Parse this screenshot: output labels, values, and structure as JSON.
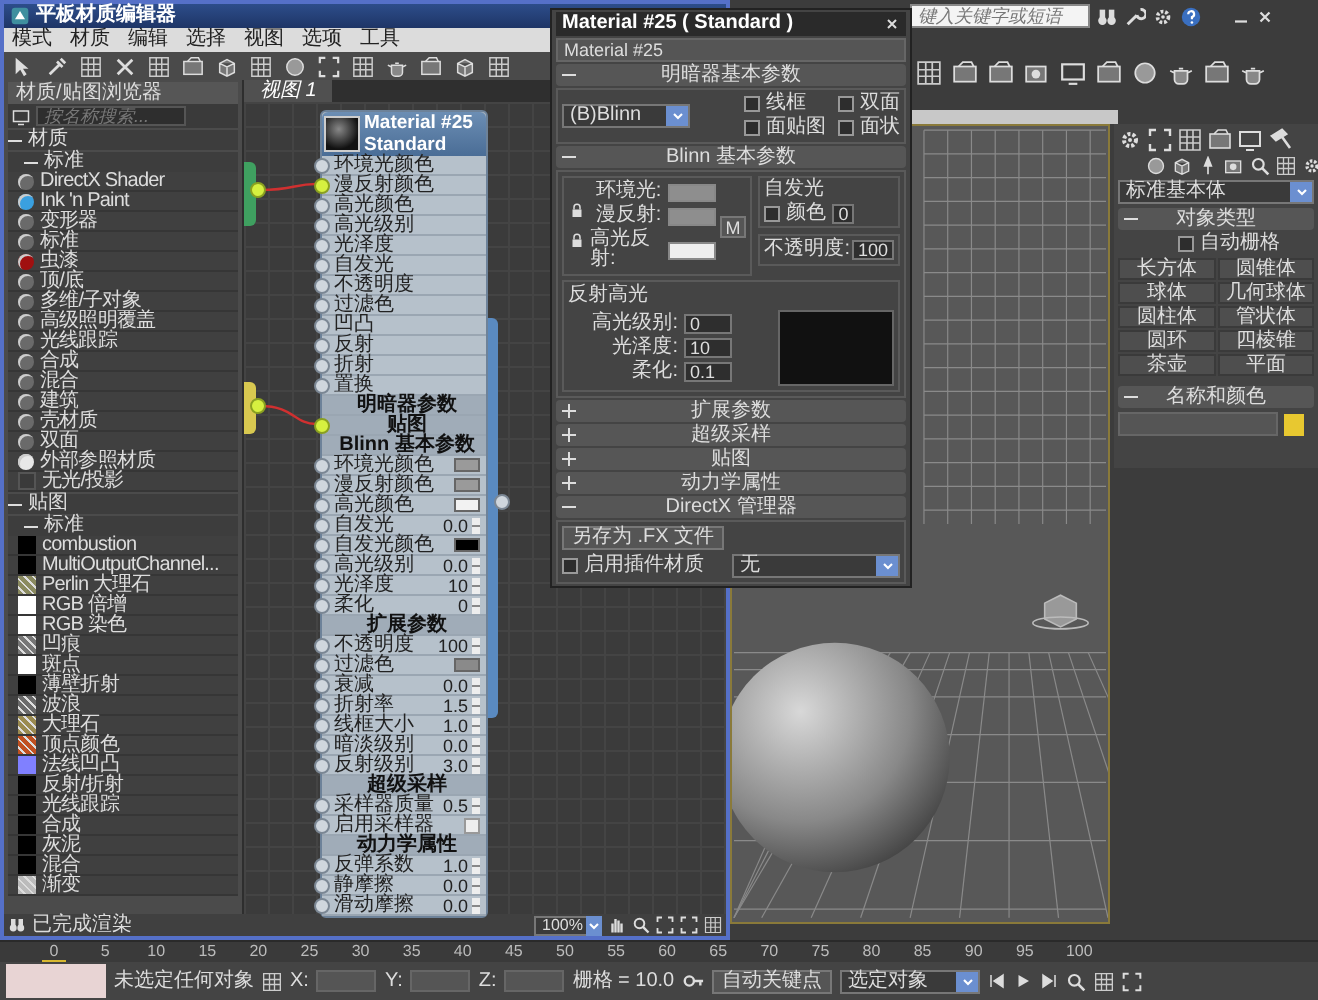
{
  "app": {
    "search": {
      "placeholder": "键入关键字或短语"
    }
  },
  "slate": {
    "title": "平板材质编辑器",
    "menu": [
      "模式",
      "材质",
      "编辑",
      "选择",
      "视图",
      "选项",
      "工具"
    ],
    "browser": {
      "title": "材质/贴图浏览器",
      "search": {
        "placeholder": "按名称搜索..."
      },
      "groups": [
        {
          "label": "材质",
          "expanded": true,
          "children": [
            {
              "label": "标准",
              "expanded": true,
              "items": [
                {
                  "label": "DirectX Shader",
                  "kind": "sphere",
                  "color": "#6a6a6a"
                },
                {
                  "label": "Ink 'n Paint",
                  "kind": "sphere",
                  "color": "#3aa0e0"
                },
                {
                  "label": "变形器",
                  "kind": "sphere",
                  "color": "#6a6a6a"
                },
                {
                  "label": "标准",
                  "kind": "sphere",
                  "color": "#6a6a6a"
                },
                {
                  "label": "虫漆",
                  "kind": "sphere",
                  "color": "#a01010"
                },
                {
                  "label": "顶/底",
                  "kind": "sphere",
                  "color": "#6a6a6a"
                },
                {
                  "label": "多维/子对象",
                  "kind": "sphere",
                  "color": "#6a6a6a"
                },
                {
                  "label": "高级照明覆盖",
                  "kind": "sphere",
                  "color": "#6a6a6a"
                },
                {
                  "label": "光线跟踪",
                  "kind": "sphere",
                  "color": "#6a6a6a"
                },
                {
                  "label": "合成",
                  "kind": "sphere",
                  "color": "#6a6a6a"
                },
                {
                  "label": "混合",
                  "kind": "sphere",
                  "color": "#6a6a6a"
                },
                {
                  "label": "建筑",
                  "kind": "sphere",
                  "color": "#6a6a6a"
                },
                {
                  "label": "壳材质",
                  "kind": "sphere",
                  "color": "#6a6a6a"
                },
                {
                  "label": "双面",
                  "kind": "sphere",
                  "color": "#6a6a6a"
                },
                {
                  "label": "外部参照材质",
                  "kind": "sphere",
                  "color": "#e8e8e8"
                },
                {
                  "label": "无光/投影",
                  "kind": "blank",
                  "color": "#3a3a3a"
                }
              ]
            }
          ]
        },
        {
          "label": "贴图",
          "expanded": true,
          "children": [
            {
              "label": "标准",
              "expanded": true,
              "items": [
                {
                  "label": "combustion",
                  "kind": "swatch",
                  "color": "#000000"
                },
                {
                  "label": "MultiOutputChannel...",
                  "kind": "swatch",
                  "color": "#000000"
                },
                {
                  "label": "Perlin 大理石",
                  "kind": "texture",
                  "color": "#8a8a60"
                },
                {
                  "label": "RGB 倍增",
                  "kind": "swatch",
                  "color": "#ffffff"
                },
                {
                  "label": "RGB 染色",
                  "kind": "swatch",
                  "color": "#ffffff"
                },
                {
                  "label": "凹痕",
                  "kind": "texture",
                  "color": "#777777"
                },
                {
                  "label": "斑点",
                  "kind": "swatch",
                  "color": "#ffffff"
                },
                {
                  "label": "薄壁折射",
                  "kind": "swatch",
                  "color": "#000000"
                },
                {
                  "label": "波浪",
                  "kind": "texture",
                  "color": "#6a6a6a"
                },
                {
                  "label": "大理石",
                  "kind": "texture",
                  "color": "#9a8a50"
                },
                {
                  "label": "顶点颜色",
                  "kind": "texture",
                  "color": "#c05020"
                },
                {
                  "label": "法线凹凸",
                  "kind": "swatch",
                  "color": "#8080ff"
                },
                {
                  "label": "反射/折射",
                  "kind": "swatch",
                  "color": "#000000"
                },
                {
                  "label": "光线跟踪",
                  "kind": "swatch",
                  "color": "#000000"
                },
                {
                  "label": "合成",
                  "kind": "swatch",
                  "color": "#000000"
                },
                {
                  "label": "灰泥",
                  "kind": "swatch",
                  "color": "#000000"
                },
                {
                  "label": "混合",
                  "kind": "swatch",
                  "color": "#000000"
                },
                {
                  "label": "渐变",
                  "kind": "texture",
                  "color": "#bbbbbb"
                }
              ]
            }
          ]
        }
      ]
    },
    "view_tabs": [
      {
        "label": "视图 1",
        "selected": true
      }
    ],
    "node": {
      "title": "Material #25",
      "subtitle": "Standard",
      "rows": [
        {
          "kind": "slot",
          "label": "环境光颜色",
          "connected": false
        },
        {
          "kind": "slot",
          "label": "漫反射颜色",
          "connected": true
        },
        {
          "kind": "slot",
          "label": "高光颜色",
          "connected": false
        },
        {
          "kind": "slot",
          "label": "高光级别",
          "connected": false
        },
        {
          "kind": "slot",
          "label": "光泽度",
          "connected": false
        },
        {
          "kind": "slot",
          "label": "自发光",
          "connected": false
        },
        {
          "kind": "slot",
          "label": "不透明度",
          "connected": false
        },
        {
          "kind": "slot",
          "label": "过滤色",
          "connected": false
        },
        {
          "kind": "slot",
          "label": "凹凸",
          "connected": false
        },
        {
          "kind": "slot",
          "label": "反射",
          "connected": false
        },
        {
          "kind": "slot",
          "label": "折射",
          "connected": false
        },
        {
          "kind": "slot",
          "label": "置换",
          "connected": false
        },
        {
          "kind": "header",
          "label": "明暗器参数",
          "connected": false
        },
        {
          "kind": "header",
          "label": "贴图",
          "connected": true
        },
        {
          "kind": "header",
          "label": "Blinn 基本参数",
          "connected": false
        },
        {
          "kind": "swatch",
          "label": "环境光颜色",
          "color": "#9a9a9a",
          "connected": false
        },
        {
          "kind": "swatch",
          "label": "漫反射颜色",
          "color": "#9a9a9a",
          "connected": false
        },
        {
          "kind": "swatch",
          "label": "高光颜色",
          "color": "#f2f2f2",
          "connected": false
        },
        {
          "kind": "number",
          "label": "自发光",
          "value": "0.0",
          "connected": false
        },
        {
          "kind": "swatch",
          "label": "自发光颜色",
          "color": "#000000",
          "connected": false
        },
        {
          "kind": "number",
          "label": "高光级别",
          "value": "0.0",
          "connected": false
        },
        {
          "kind": "number",
          "label": "光泽度",
          "value": "10",
          "connected": false
        },
        {
          "kind": "number",
          "label": "柔化",
          "value": "0",
          "connected": false
        },
        {
          "kind": "header",
          "label": "扩展参数",
          "connected": false
        },
        {
          "kind": "number",
          "label": "不透明度",
          "value": "100",
          "connected": false
        },
        {
          "kind": "swatch",
          "label": "过滤色",
          "color": "#8a8a8a",
          "connected": false
        },
        {
          "kind": "number",
          "label": "衰减",
          "value": "0.0",
          "connected": false
        },
        {
          "kind": "number",
          "label": "折射率",
          "value": "1.5",
          "connected": false
        },
        {
          "kind": "number",
          "label": "线框大小",
          "value": "1.0",
          "connected": false
        },
        {
          "kind": "number",
          "label": "暗淡级别",
          "value": "0.0",
          "connected": false
        },
        {
          "kind": "number",
          "label": "反射级别",
          "value": "3.0",
          "connected": false
        },
        {
          "kind": "header",
          "label": "超级采样",
          "connected": false
        },
        {
          "kind": "number",
          "label": "采样器质量",
          "value": "0.5",
          "connected": false
        },
        {
          "kind": "checkbox",
          "label": "启用采样器",
          "checked": false,
          "connected": false
        },
        {
          "kind": "header",
          "label": "动力学属性",
          "connected": false
        },
        {
          "kind": "number",
          "label": "反弹系数",
          "value": "1.0",
          "connected": false
        },
        {
          "kind": "number",
          "label": "静摩擦",
          "value": "0.0",
          "connected": false
        },
        {
          "kind": "number",
          "label": "滑动摩擦",
          "value": "0.0",
          "connected": false
        }
      ]
    },
    "status": "已完成渲染",
    "zoom": "100%"
  },
  "material_dialog": {
    "title": "Material #25  ( Standard )",
    "name": "Material #25",
    "shader_rollout": {
      "title": "明暗器基本参数",
      "expanded": true,
      "shader": "(B)Blinn",
      "options": [
        {
          "label": "线框",
          "checked": false
        },
        {
          "label": "双面",
          "checked": false
        },
        {
          "label": "面贴图",
          "checked": false
        },
        {
          "label": "面状",
          "checked": false
        }
      ]
    },
    "blinn_rollout": {
      "title": "Blinn 基本参数",
      "expanded": true,
      "colors": [
        {
          "label": "环境光:",
          "color": "#8e8e8e"
        },
        {
          "label": "漫反射:",
          "color": "#8e8e8e"
        },
        {
          "label": "高光反射:",
          "color": "#eeeeee"
        }
      ],
      "map_button": "M",
      "self_illum": {
        "title": "自发光",
        "label": "颜色",
        "checked": false,
        "value": "0"
      },
      "opacity": {
        "label": "不透明度:",
        "value": "100"
      },
      "highlights": {
        "title": "反射高光",
        "params": [
          {
            "label": "高光级别:",
            "value": "0"
          },
          {
            "label": "光泽度:",
            "value": "10"
          },
          {
            "label": "柔化:",
            "value": "0.1"
          }
        ]
      }
    },
    "rollouts": [
      {
        "title": "扩展参数",
        "expanded": false
      },
      {
        "title": "超级采样",
        "expanded": false
      },
      {
        "title": "贴图",
        "expanded": false
      },
      {
        "title": "动力学属性",
        "expanded": false
      }
    ],
    "directx_rollout": {
      "title": "DirectX 管理器",
      "expanded": true,
      "save_button": "另存为 .FX 文件",
      "plugin": {
        "label": "启用插件材质",
        "checked": false
      },
      "plugin_value": "无"
    }
  },
  "command_panel": {
    "category": "标准基本体",
    "object_type": {
      "title": "对象类型",
      "expanded": true,
      "autogrid": {
        "label": "自动栅格",
        "checked": false
      },
      "buttons": [
        "长方体",
        "圆锥体",
        "球体",
        "几何球体",
        "圆柱体",
        "管状体",
        "圆环",
        "四棱锥",
        "茶壶",
        "平面"
      ]
    },
    "name_color": {
      "title": "名称和颜色",
      "expanded": true,
      "color": "#e8c830"
    }
  },
  "timeline": {
    "level": 0,
    "ticks": [
      "0",
      "5",
      "10",
      "15",
      "20",
      "25",
      "30",
      "35",
      "40",
      "45",
      "50",
      "55",
      "60",
      "65",
      "70",
      "75",
      "80",
      "85",
      "90",
      "95",
      "100"
    ]
  },
  "status_bar": {
    "message": "未选定任何对象",
    "coords": [
      "X:",
      "Y:",
      "Z:"
    ],
    "grid": "栅格 = 10.0",
    "autokey": "自动关键点",
    "selection": "选定对象"
  }
}
